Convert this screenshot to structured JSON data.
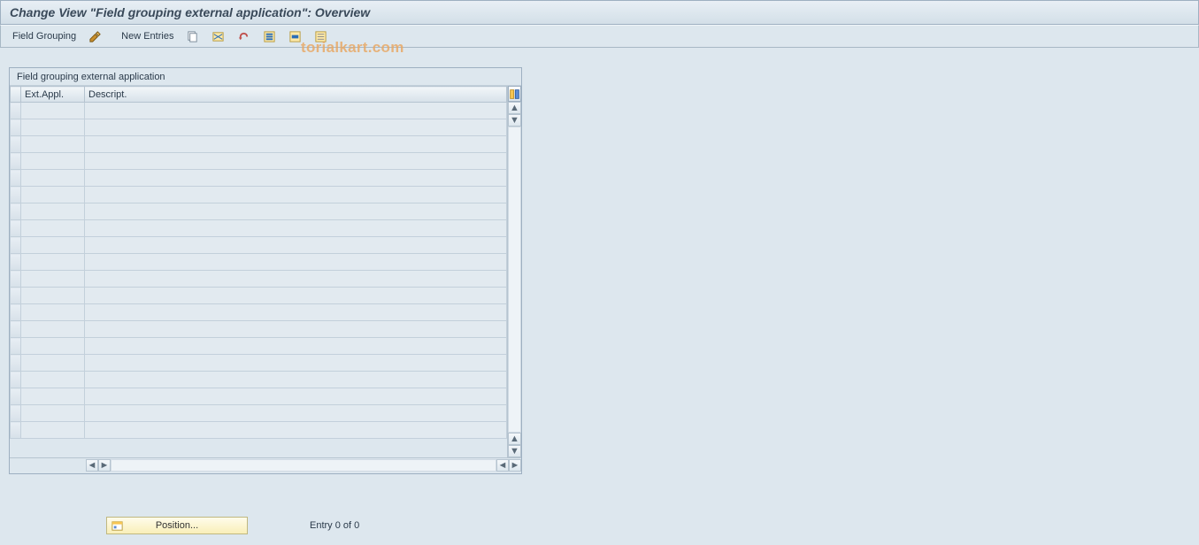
{
  "title": "Change View \"Field grouping external application\": Overview",
  "toolbar": {
    "field_grouping": "Field Grouping",
    "new_entries": "New Entries"
  },
  "panel": {
    "header": "Field grouping external application",
    "columns": {
      "ext_appl": "Ext.Appl.",
      "descript": "Descript."
    }
  },
  "footer": {
    "position_btn": "Position...",
    "entry_text": "Entry 0 of 0"
  },
  "watermark": "torialkart.com",
  "row_count": 20
}
